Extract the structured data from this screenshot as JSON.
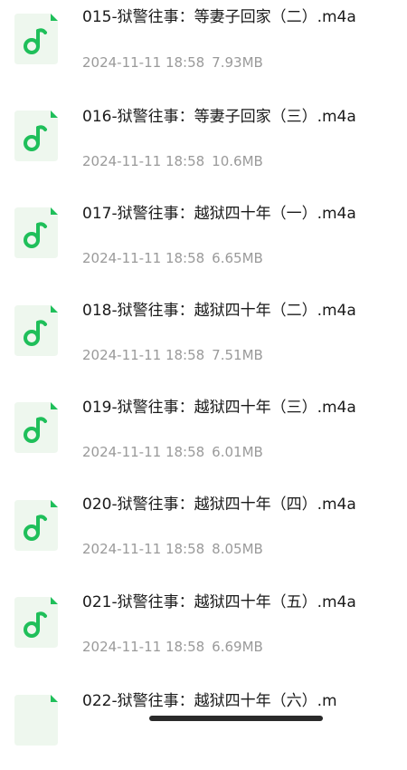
{
  "colors": {
    "accent": "#1fbf5a",
    "icon_bg": "#eef7ee",
    "text_primary": "#1a1a1a",
    "text_secondary": "#9a9a9a"
  },
  "files": [
    {
      "name": "015-狱警往事：等妻子回家（二）.m4a",
      "date": "2024-11-11 18:58",
      "size": "7.93MB",
      "icon": "music-note-icon"
    },
    {
      "name": "016-狱警往事：等妻子回家（三）.m4a",
      "date": "2024-11-11 18:58",
      "size": "10.6MB",
      "icon": "music-note-icon"
    },
    {
      "name": "017-狱警往事：越狱四十年（一）.m4a",
      "date": "2024-11-11 18:58",
      "size": "6.65MB",
      "icon": "music-note-icon"
    },
    {
      "name": "018-狱警往事：越狱四十年（二）.m4a",
      "date": "2024-11-11 18:58",
      "size": "7.51MB",
      "icon": "music-note-icon"
    },
    {
      "name": "019-狱警往事：越狱四十年（三）.m4a",
      "date": "2024-11-11 18:58",
      "size": "6.01MB",
      "icon": "music-note-icon"
    },
    {
      "name": "020-狱警往事：越狱四十年（四）.m4a",
      "date": "2024-11-11 18:58",
      "size": "8.05MB",
      "icon": "music-note-icon"
    },
    {
      "name": "021-狱警往事：越狱四十年（五）.m4a",
      "date": "2024-11-11 18:58",
      "size": "6.69MB",
      "icon": "music-note-icon"
    },
    {
      "name": "022-狱警往事：越狱四十年（六）.m",
      "date": "",
      "size": "",
      "icon": "music-note-icon"
    }
  ]
}
